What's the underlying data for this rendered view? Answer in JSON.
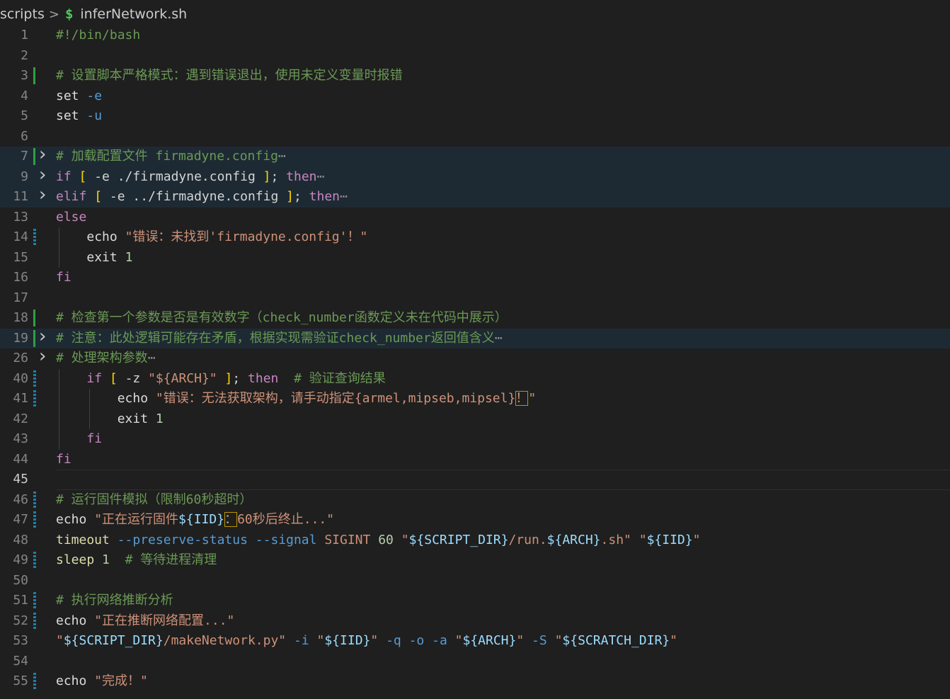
{
  "breadcrumb": {
    "folder": "scripts",
    "separator": ">",
    "file_icon": "dollar-shell-icon",
    "file_icon_glyph": "$",
    "file": "inferNetwork.sh"
  },
  "editor": {
    "language": "bash",
    "current_line": 45,
    "lines": [
      {
        "n": "1",
        "tokens": [
          {
            "t": "#!/bin/bash",
            "c": "comment"
          }
        ]
      },
      {
        "n": "2",
        "tokens": []
      },
      {
        "n": "3",
        "mark": "added",
        "tokens": [
          {
            "t": "# 设置脚本严格模式：遇到错误退出，使用未定义变量时报错",
            "c": "comment"
          }
        ]
      },
      {
        "n": "4",
        "tokens": [
          {
            "t": "set",
            "c": "cmdwhite"
          },
          {
            "t": " ",
            "c": "plain"
          },
          {
            "t": "-e",
            "c": "opt"
          }
        ]
      },
      {
        "n": "5",
        "tokens": [
          {
            "t": "set",
            "c": "cmdwhite"
          },
          {
            "t": " ",
            "c": "plain"
          },
          {
            "t": "-u",
            "c": "opt"
          }
        ]
      },
      {
        "n": "6",
        "tokens": []
      },
      {
        "n": "7",
        "mark": "added",
        "fold": true,
        "folded": true,
        "tokens": [
          {
            "t": "# 加载配置文件 firmadyne.config",
            "c": "comment"
          },
          {
            "t": "⋯",
            "c": "fold"
          }
        ]
      },
      {
        "n": "9",
        "fold": true,
        "folded": true,
        "tokens": [
          {
            "t": "if",
            "c": "kw"
          },
          {
            "t": " ",
            "c": "plain"
          },
          {
            "t": "[",
            "c": "bracket1"
          },
          {
            "t": " -e ./firmadyne.config ",
            "c": "plain"
          },
          {
            "t": "]",
            "c": "bracket1"
          },
          {
            "t": "; ",
            "c": "plain"
          },
          {
            "t": "then",
            "c": "kw"
          },
          {
            "t": "⋯",
            "c": "fold"
          }
        ]
      },
      {
        "n": "11",
        "fold": true,
        "folded": true,
        "tokens": [
          {
            "t": "elif",
            "c": "kw"
          },
          {
            "t": " ",
            "c": "plain"
          },
          {
            "t": "[",
            "c": "bracket1"
          },
          {
            "t": " -e ../firmadyne.config ",
            "c": "plain"
          },
          {
            "t": "]",
            "c": "bracket1"
          },
          {
            "t": "; ",
            "c": "plain"
          },
          {
            "t": "then",
            "c": "kw"
          },
          {
            "t": "⋯",
            "c": "fold"
          }
        ]
      },
      {
        "n": "13",
        "tokens": [
          {
            "t": "else",
            "c": "kw"
          }
        ]
      },
      {
        "n": "14",
        "mark": "modified",
        "indent": 1,
        "tokens": [
          {
            "t": "    ",
            "c": "plain"
          },
          {
            "t": "echo",
            "c": "cmdwhite"
          },
          {
            "t": " ",
            "c": "plain"
          },
          {
            "t": "\"错误：未找到'firmadyne.config'！\"",
            "c": "str"
          }
        ]
      },
      {
        "n": "15",
        "indent": 1,
        "tokens": [
          {
            "t": "    ",
            "c": "plain"
          },
          {
            "t": "exit",
            "c": "cmdwhite"
          },
          {
            "t": " ",
            "c": "plain"
          },
          {
            "t": "1",
            "c": "num"
          }
        ]
      },
      {
        "n": "16",
        "tokens": [
          {
            "t": "fi",
            "c": "kw"
          }
        ]
      },
      {
        "n": "17",
        "tokens": []
      },
      {
        "n": "18",
        "mark": "added",
        "tokens": [
          {
            "t": "# 检查第一个参数是否是有效数字（check_number函数定义未在代码中展示）",
            "c": "comment"
          }
        ]
      },
      {
        "n": "19",
        "mark": "added",
        "fold": true,
        "folded": true,
        "tokens": [
          {
            "t": "# 注意：此处逻辑可能存在矛盾，根据实现需验证check_number返回值含义",
            "c": "comment"
          },
          {
            "t": "⋯",
            "c": "fold"
          }
        ]
      },
      {
        "n": "26",
        "fold": true,
        "tokens": [
          {
            "t": "# 处理架构参数",
            "c": "comment"
          },
          {
            "t": "⋯",
            "c": "fold"
          }
        ]
      },
      {
        "n": "40",
        "mark": "modified",
        "indent": 1,
        "tokens": [
          {
            "t": "    ",
            "c": "plain"
          },
          {
            "t": "if",
            "c": "kw"
          },
          {
            "t": " ",
            "c": "plain"
          },
          {
            "t": "[",
            "c": "bracket1"
          },
          {
            "t": " -z ",
            "c": "plain"
          },
          {
            "t": "\"${ARCH}\"",
            "c": "str"
          },
          {
            "t": " ",
            "c": "plain"
          },
          {
            "t": "]",
            "c": "bracket1"
          },
          {
            "t": "; ",
            "c": "plain"
          },
          {
            "t": "then",
            "c": "kw"
          },
          {
            "t": "  ",
            "c": "plain"
          },
          {
            "t": "# 验证查询结果",
            "c": "comment"
          }
        ]
      },
      {
        "n": "41",
        "mark": "modified",
        "indent": 2,
        "tokens": [
          {
            "t": "        ",
            "c": "plain"
          },
          {
            "t": "echo",
            "c": "cmdwhite"
          },
          {
            "t": " ",
            "c": "plain"
          },
          {
            "t": "\"错误：无法获取架构，请手动指定{armel,mipseb,mipsel}",
            "c": "str"
          },
          {
            "t": "！",
            "c": "str",
            "box": true
          },
          {
            "t": "\"",
            "c": "str"
          }
        ]
      },
      {
        "n": "42",
        "indent": 2,
        "tokens": [
          {
            "t": "        ",
            "c": "plain"
          },
          {
            "t": "exit",
            "c": "cmdwhite"
          },
          {
            "t": " ",
            "c": "plain"
          },
          {
            "t": "1",
            "c": "num"
          }
        ]
      },
      {
        "n": "43",
        "indent": 1,
        "tokens": [
          {
            "t": "    ",
            "c": "plain"
          },
          {
            "t": "fi",
            "c": "kw"
          }
        ]
      },
      {
        "n": "44",
        "tokens": [
          {
            "t": "fi",
            "c": "kw"
          }
        ]
      },
      {
        "n": "45",
        "current": true,
        "tokens": []
      },
      {
        "n": "46",
        "mark": "modified",
        "tokens": [
          {
            "t": "# 运行固件模拟（限制60秒超时）",
            "c": "comment"
          }
        ]
      },
      {
        "n": "47",
        "mark": "modified",
        "tokens": [
          {
            "t": "echo",
            "c": "cmdwhite"
          },
          {
            "t": " ",
            "c": "plain"
          },
          {
            "t": "\"正在运行固件",
            "c": "str"
          },
          {
            "t": "${IID}",
            "c": "var"
          },
          {
            "t": "：",
            "c": "str",
            "box": true
          },
          {
            "t": "60秒后终止...\"",
            "c": "str"
          }
        ]
      },
      {
        "n": "48",
        "tokens": [
          {
            "t": "timeout",
            "c": "cmd"
          },
          {
            "t": " ",
            "c": "plain"
          },
          {
            "t": "--preserve-status",
            "c": "opt"
          },
          {
            "t": " ",
            "c": "plain"
          },
          {
            "t": "--signal",
            "c": "opt"
          },
          {
            "t": " ",
            "c": "plain"
          },
          {
            "t": "SIGINT",
            "c": "str"
          },
          {
            "t": " ",
            "c": "plain"
          },
          {
            "t": "60",
            "c": "num"
          },
          {
            "t": " ",
            "c": "plain"
          },
          {
            "t": "\"",
            "c": "str"
          },
          {
            "t": "${SCRIPT_DIR}",
            "c": "var"
          },
          {
            "t": "/run.",
            "c": "str"
          },
          {
            "t": "${ARCH}",
            "c": "var"
          },
          {
            "t": ".sh\"",
            "c": "str"
          },
          {
            "t": " ",
            "c": "plain"
          },
          {
            "t": "\"",
            "c": "str"
          },
          {
            "t": "${IID}",
            "c": "var"
          },
          {
            "t": "\"",
            "c": "str"
          }
        ]
      },
      {
        "n": "49",
        "mark": "modified",
        "tokens": [
          {
            "t": "sleep",
            "c": "cmd"
          },
          {
            "t": " ",
            "c": "plain"
          },
          {
            "t": "1",
            "c": "num"
          },
          {
            "t": "  ",
            "c": "plain"
          },
          {
            "t": "# 等待进程清理",
            "c": "comment"
          }
        ]
      },
      {
        "n": "50",
        "tokens": []
      },
      {
        "n": "51",
        "mark": "modified",
        "tokens": [
          {
            "t": "# 执行网络推断分析",
            "c": "comment"
          }
        ]
      },
      {
        "n": "52",
        "mark": "modified",
        "tokens": [
          {
            "t": "echo",
            "c": "cmdwhite"
          },
          {
            "t": " ",
            "c": "plain"
          },
          {
            "t": "\"正在推断网络配置...\"",
            "c": "str"
          }
        ]
      },
      {
        "n": "53",
        "tokens": [
          {
            "t": "\"",
            "c": "str"
          },
          {
            "t": "${SCRIPT_DIR}",
            "c": "var"
          },
          {
            "t": "/makeNetwork.py\"",
            "c": "str"
          },
          {
            "t": " ",
            "c": "plain"
          },
          {
            "t": "-i",
            "c": "opt"
          },
          {
            "t": " ",
            "c": "plain"
          },
          {
            "t": "\"",
            "c": "str"
          },
          {
            "t": "${IID}",
            "c": "var"
          },
          {
            "t": "\"",
            "c": "str"
          },
          {
            "t": " ",
            "c": "plain"
          },
          {
            "t": "-q",
            "c": "opt"
          },
          {
            "t": " ",
            "c": "plain"
          },
          {
            "t": "-o",
            "c": "opt"
          },
          {
            "t": " ",
            "c": "plain"
          },
          {
            "t": "-a",
            "c": "opt"
          },
          {
            "t": " ",
            "c": "plain"
          },
          {
            "t": "\"",
            "c": "str"
          },
          {
            "t": "${ARCH}",
            "c": "var"
          },
          {
            "t": "\"",
            "c": "str"
          },
          {
            "t": " ",
            "c": "plain"
          },
          {
            "t": "-S",
            "c": "opt"
          },
          {
            "t": " ",
            "c": "plain"
          },
          {
            "t": "\"",
            "c": "str"
          },
          {
            "t": "${SCRATCH_DIR}",
            "c": "var"
          },
          {
            "t": "\"",
            "c": "str"
          }
        ]
      },
      {
        "n": "54",
        "tokens": []
      },
      {
        "n": "55",
        "mark": "modified",
        "tokens": [
          {
            "t": "echo",
            "c": "cmdwhite"
          },
          {
            "t": " ",
            "c": "plain"
          },
          {
            "t": "\"完成！\"",
            "c": "str"
          }
        ]
      }
    ]
  }
}
